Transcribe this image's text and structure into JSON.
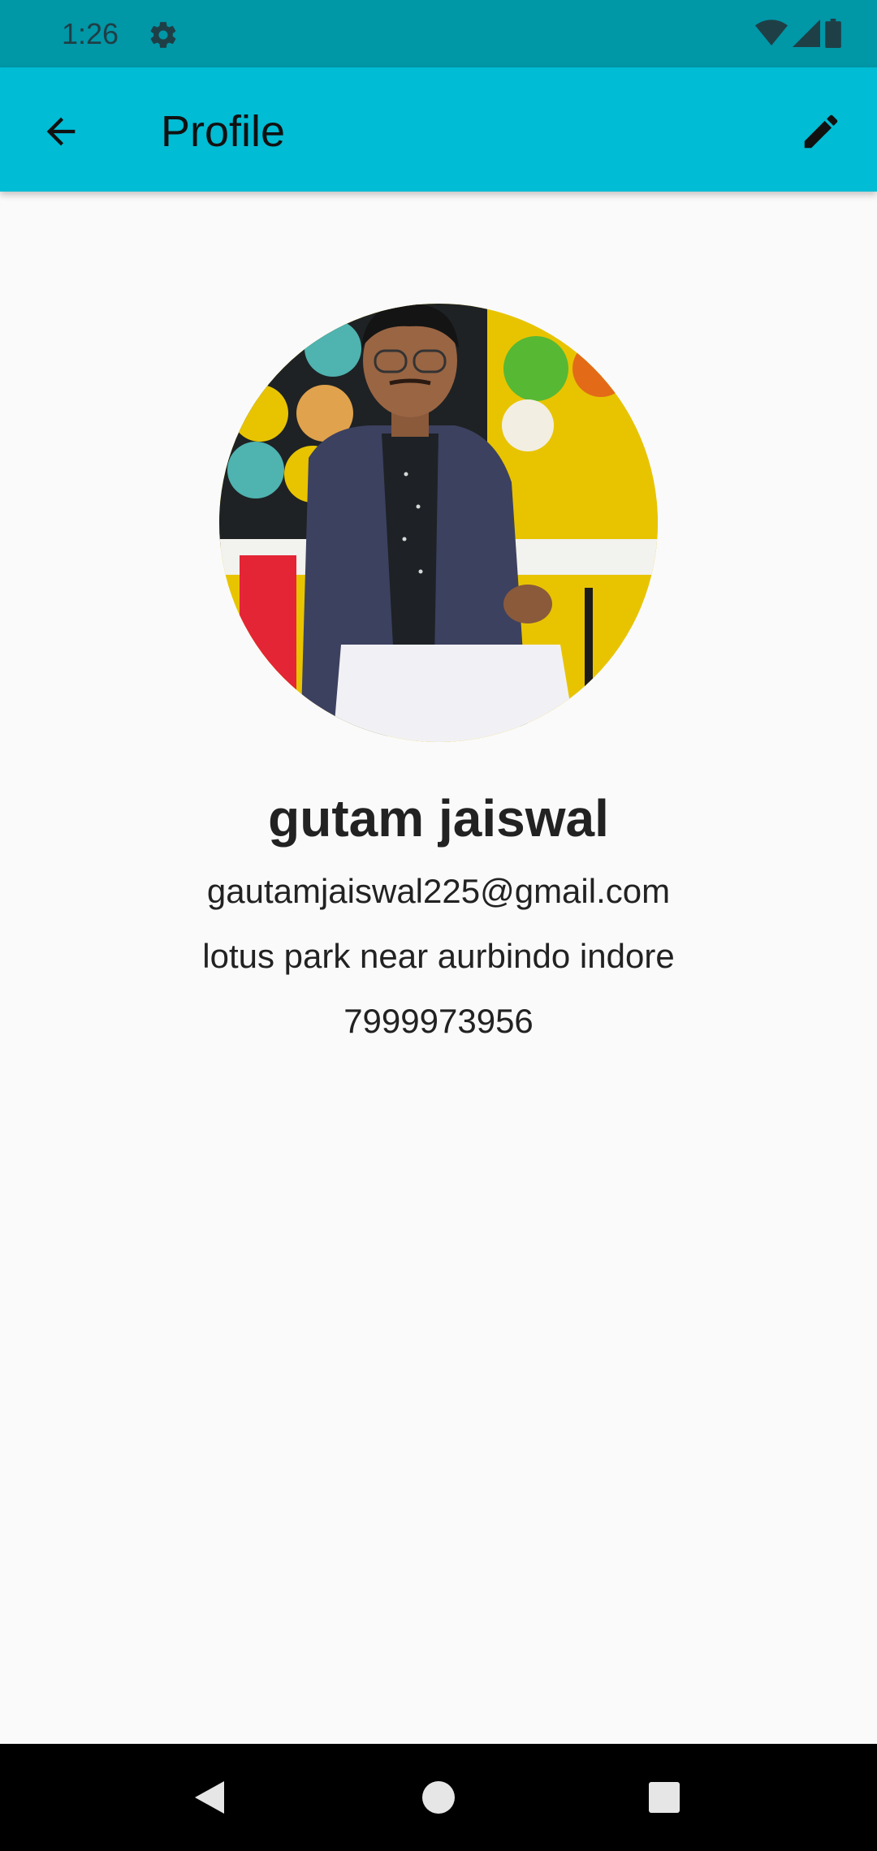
{
  "status_bar": {
    "time": "1:26",
    "icons": [
      "gear-icon",
      "wifi-icon",
      "signal-icon",
      "battery-icon"
    ]
  },
  "app_bar": {
    "title": "Profile",
    "back_icon": "arrow-back-icon",
    "edit_icon": "edit-pencil-icon"
  },
  "profile": {
    "avatar_icon": "profile-photo",
    "name": "gutam jaiswal",
    "email": "gautamjaiswal225@gmail.com",
    "address": "lotus park near aurbindo indore",
    "phone": "7999973956"
  },
  "nav_bar": {
    "back_icon": "nav-back-icon",
    "home_icon": "nav-home-icon",
    "recent_icon": "nav-recent-icon"
  },
  "colors": {
    "status_bar": "#0097a7",
    "app_bar": "#00bcd4",
    "background": "#fafafa",
    "nav_bar": "#000000",
    "text": "#222222"
  }
}
